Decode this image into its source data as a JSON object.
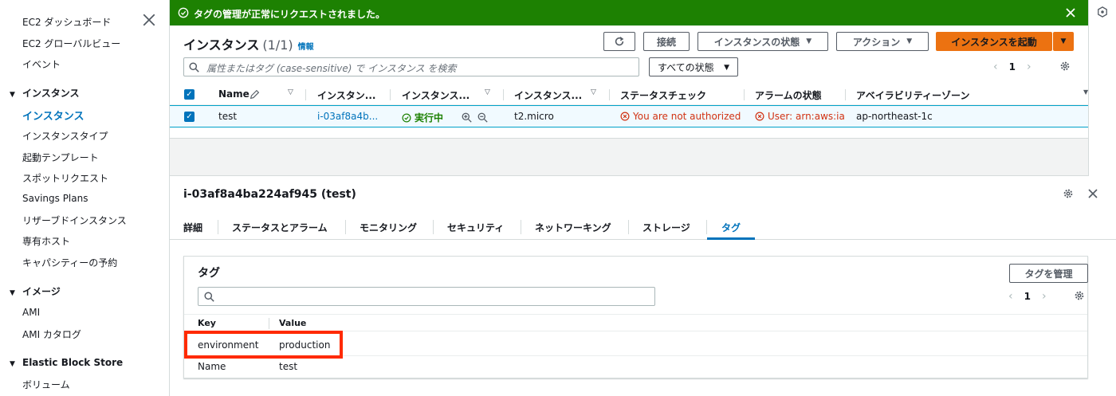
{
  "sidebar": {
    "items_top": [
      "EC2 ダッシュボード",
      "EC2 グローバルビュー",
      "イベント"
    ],
    "sections": [
      {
        "title": "インスタンス",
        "items": [
          "インスタンス",
          "インスタンスタイプ",
          "起動テンプレート",
          "スポットリクエスト",
          "Savings Plans",
          "リザーブドインスタンス",
          "専有ホスト",
          "キャパシティーの予約"
        ],
        "active_index": 0
      },
      {
        "title": "イメージ",
        "items": [
          "AMI",
          "AMI カタログ"
        ]
      },
      {
        "title": "Elastic Block Store",
        "items": [
          "ボリューム"
        ]
      }
    ]
  },
  "flash": {
    "message": "タグの管理が正常にリクエストされました。",
    "color": "#1d8102"
  },
  "instances": {
    "title": "インスタンス",
    "count": "(1/1)",
    "info": "情報",
    "buttons": {
      "connect": "接続",
      "state": "インスタンスの状態",
      "actions": "アクション",
      "launch": "インスタンスを起動"
    },
    "search_placeholder": "属性またはタグ (case-sensitive) で インスタンス を検索",
    "filter": "すべての状態",
    "page": "1",
    "columns": [
      "Name",
      "インスタン...",
      "インスタンス...",
      "インスタンス...",
      "ステータスチェック",
      "アラームの状態",
      "アベイラビリティーゾーン"
    ],
    "row": {
      "name": "test",
      "id": "i-03af8a4b...",
      "state": "実行中",
      "type": "t2.micro",
      "status_check": "You are not authorized t",
      "alarm": "User: arn:aws:iar",
      "az": "ap-northeast-1c"
    }
  },
  "details": {
    "title": "i-03af8a4ba224af945 (test)",
    "tabs": [
      "詳細",
      "ステータスとアラーム",
      "モニタリング",
      "セキュリティ",
      "ネットワーキング",
      "ストレージ",
      "タグ"
    ],
    "active_tab": "タグ",
    "tags_card": {
      "title": "タグ",
      "manage_button": "タグを管理",
      "page": "1",
      "columns": {
        "key": "Key",
        "value": "Value"
      },
      "rows": [
        {
          "key": "environment",
          "value": "production"
        },
        {
          "key": "Name",
          "value": "test"
        }
      ]
    }
  },
  "colors": {
    "primary": "#ec7211",
    "link": "#0073bb",
    "error": "#d13212",
    "highlight": "#ff2a00"
  }
}
